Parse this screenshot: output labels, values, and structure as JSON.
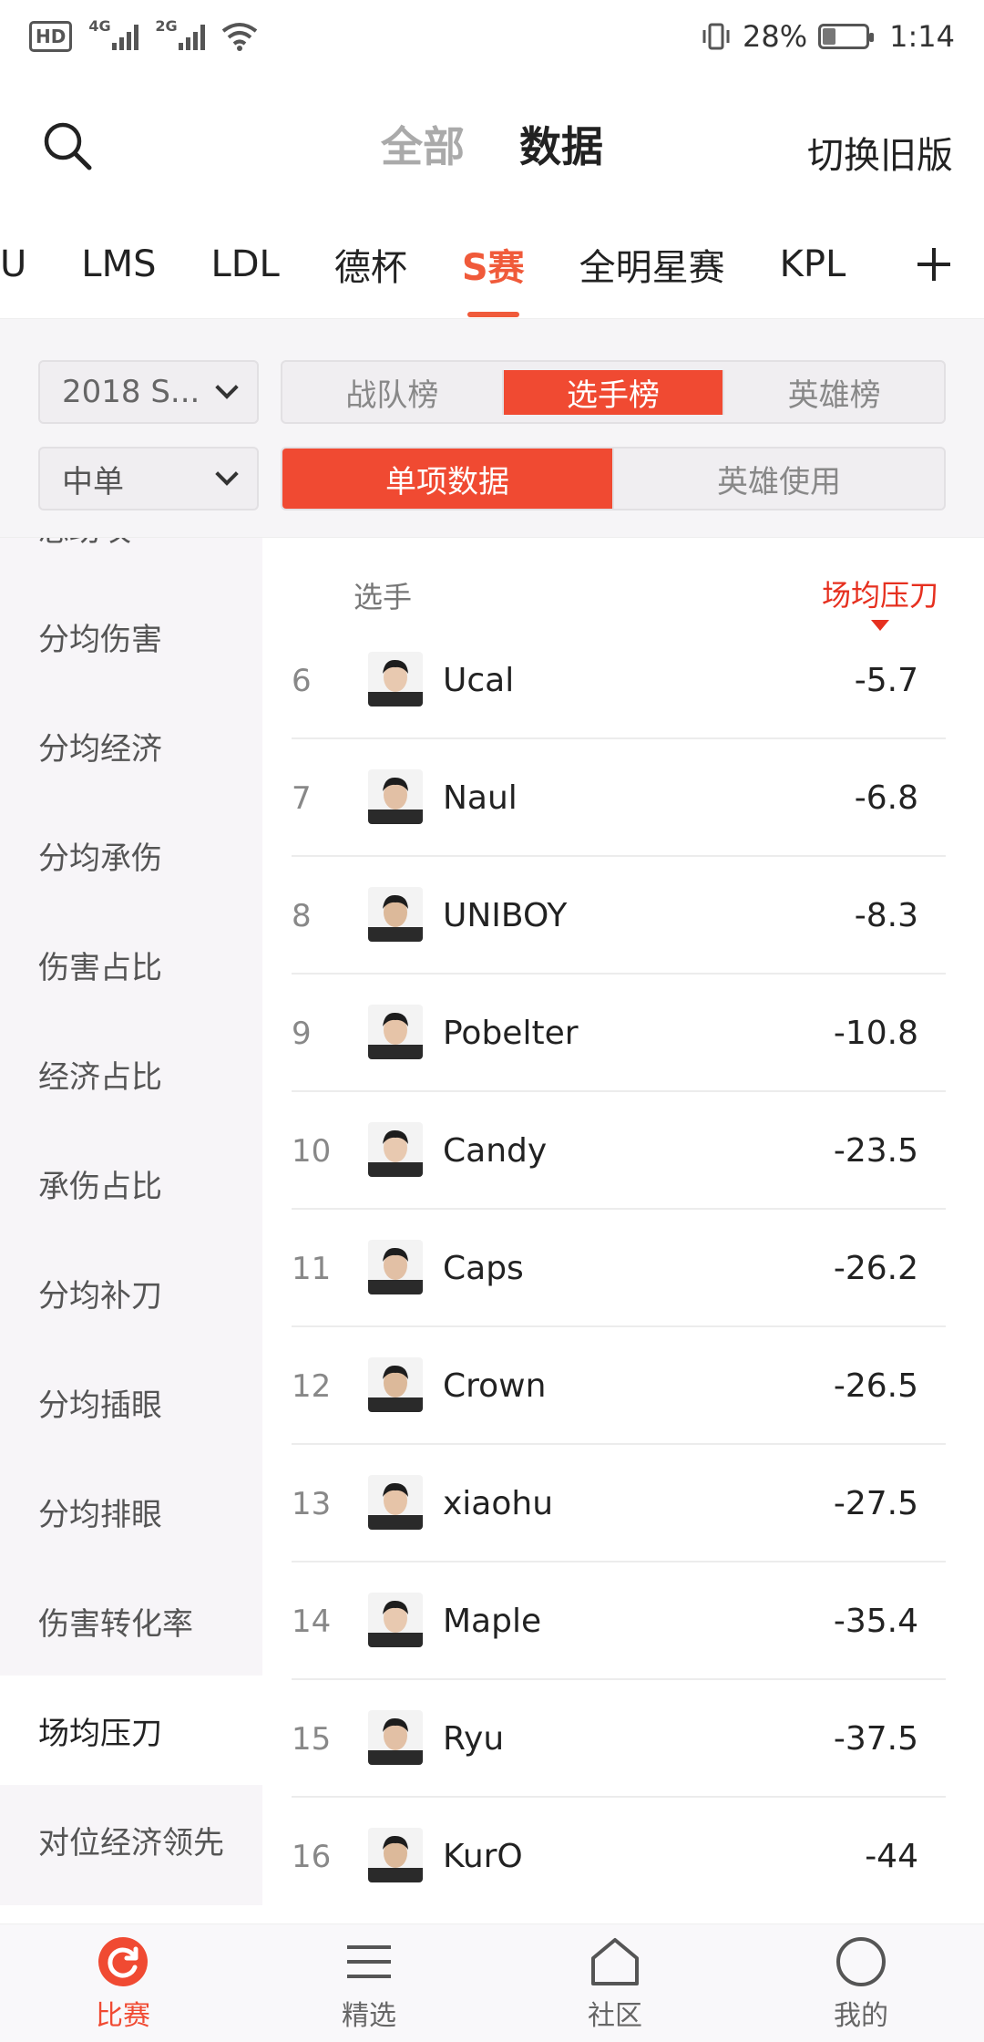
{
  "status_bar": {
    "hd": "HD",
    "net1": "4G",
    "net2": "2G",
    "battery_pct": "28%",
    "battery_level": 0.28,
    "time": "1:14"
  },
  "header": {
    "tab_all": "全部",
    "tab_data": "数据",
    "switch_old": "切换旧版"
  },
  "league_tabs": [
    "U",
    "LMS",
    "LDL",
    "德杯",
    "S赛",
    "全明星赛",
    "KPL"
  ],
  "league_active": "S赛",
  "filters": {
    "season": "2018 S...",
    "position": "中单",
    "rank_tabs": [
      "战队榜",
      "选手榜",
      "英雄榜"
    ],
    "stat_tabs": [
      "单项数据",
      "英雄使用"
    ]
  },
  "sidebar": {
    "items": [
      "总助攻",
      "分均伤害",
      "分均经济",
      "分均承伤",
      "伤害占比",
      "经济占比",
      "承伤占比",
      "分均补刀",
      "分均插眼",
      "分均排眼",
      "伤害转化率",
      "场均压刀",
      "对位经济领先"
    ],
    "active": "场均压刀"
  },
  "table": {
    "col_player": "选手",
    "col_stat": "场均压刀",
    "rows": [
      {
        "rank": "6",
        "name": "Ucal",
        "value": "-5.7"
      },
      {
        "rank": "7",
        "name": "Naul",
        "value": "-6.8"
      },
      {
        "rank": "8",
        "name": "UNIBOY",
        "value": "-8.3"
      },
      {
        "rank": "9",
        "name": "Pobelter",
        "value": "-10.8"
      },
      {
        "rank": "10",
        "name": "Candy",
        "value": "-23.5"
      },
      {
        "rank": "11",
        "name": "Caps",
        "value": "-26.2"
      },
      {
        "rank": "12",
        "name": "Crown",
        "value": "-26.5"
      },
      {
        "rank": "13",
        "name": "xiaohu",
        "value": "-27.5"
      },
      {
        "rank": "14",
        "name": "Maple",
        "value": "-35.4"
      },
      {
        "rank": "15",
        "name": "Ryu",
        "value": "-37.5"
      },
      {
        "rank": "16",
        "name": "KurO",
        "value": "-44"
      }
    ]
  },
  "bottom_nav": [
    {
      "label": "比赛",
      "icon": "match-icon"
    },
    {
      "label": "精选",
      "icon": "menu-icon"
    },
    {
      "label": "社区",
      "icon": "home-icon"
    },
    {
      "label": "我的",
      "icon": "profile-icon"
    }
  ],
  "colors": {
    "accent": "#f04a32",
    "stat_header": "#e6301f"
  }
}
